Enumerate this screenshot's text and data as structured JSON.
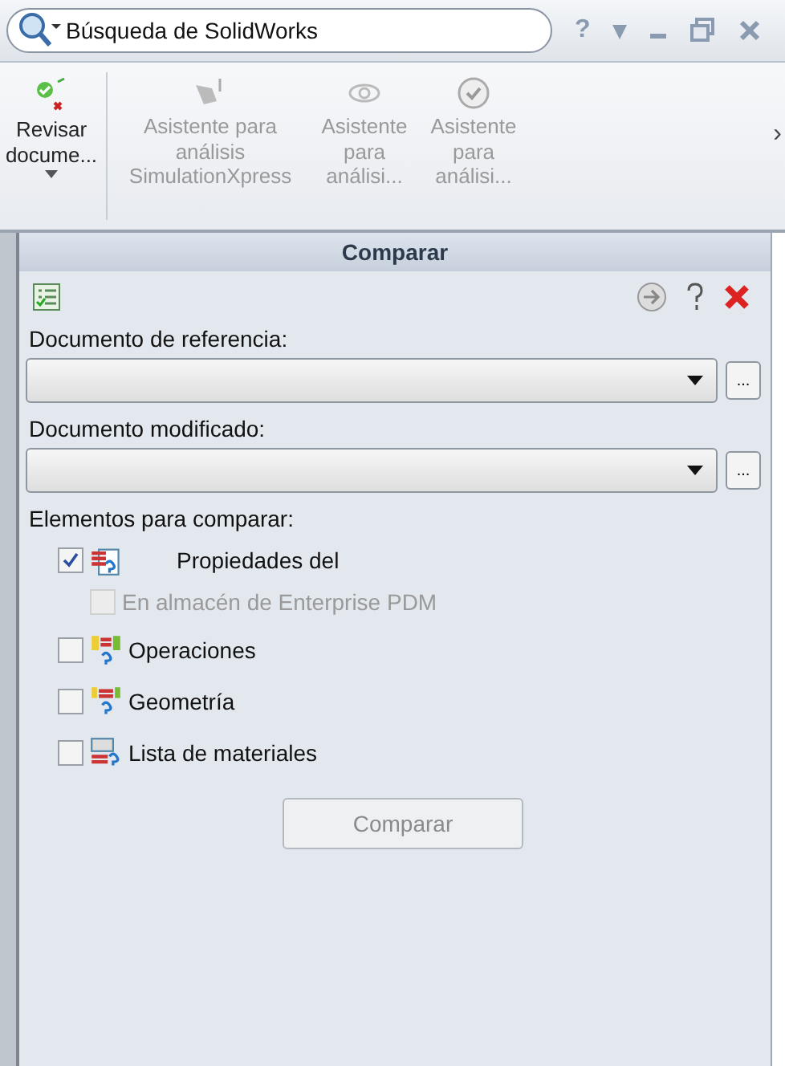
{
  "search": {
    "placeholder": "Búsqueda de SolidWorks"
  },
  "window_controls": [
    "?",
    "▾"
  ],
  "toolbar": {
    "more": "›",
    "buttons": [
      {
        "label": "Revisar docume...",
        "disabled": false,
        "dropdown": true
      },
      {
        "label": "Asistente para análisis SimulationXpress",
        "disabled": true,
        "dropdown": false
      },
      {
        "label": "Asistente para análisi...",
        "disabled": true,
        "dropdown": false
      },
      {
        "label": "Asistente para análisi...",
        "disabled": true,
        "dropdown": false
      }
    ]
  },
  "panel": {
    "title": "Comparar",
    "reference": {
      "label": "Documento de referencia:",
      "browse": "..."
    },
    "modified": {
      "label": "Documento modificado:",
      "browse": "..."
    },
    "elements_label": "Elementos para comparar:",
    "items": [
      {
        "label": "Propiedades del",
        "checked": true,
        "disabled": false,
        "children": [
          {
            "label": "En almacén de Enterprise PDM",
            "checked": false,
            "disabled": true
          }
        ]
      },
      {
        "label": "Operaciones",
        "checked": false,
        "disabled": false
      },
      {
        "label": "Geometría",
        "checked": false,
        "disabled": false
      },
      {
        "label": "Lista de materiales",
        "checked": false,
        "disabled": false
      }
    ],
    "button": {
      "label": "Comparar",
      "disabled": true
    }
  }
}
